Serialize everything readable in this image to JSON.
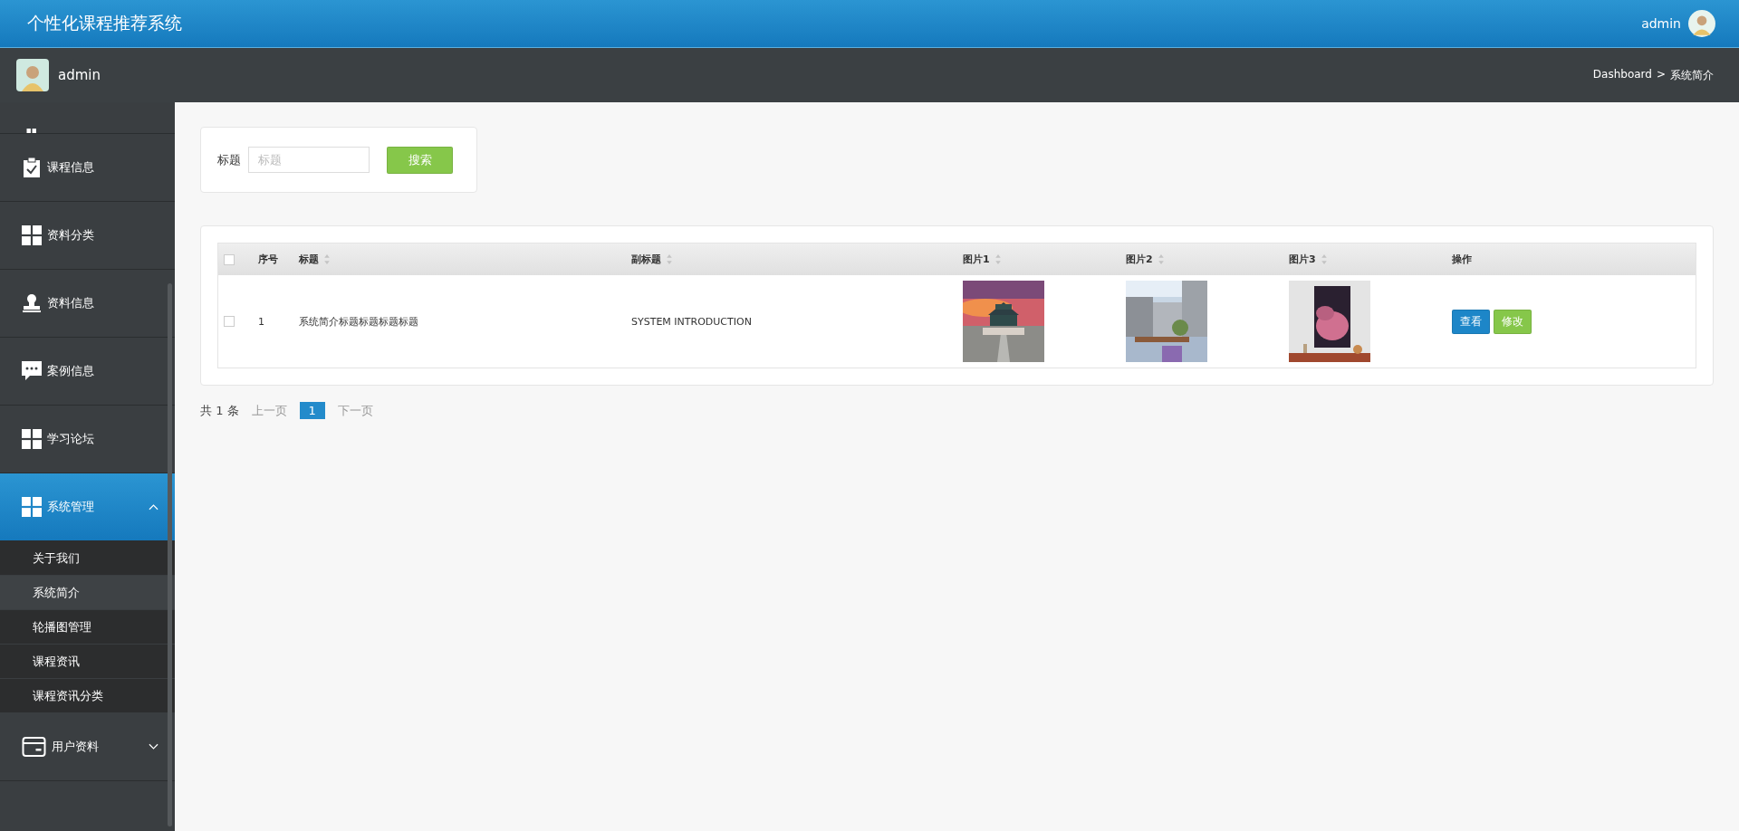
{
  "header": {
    "title": "个性化课程推荐系统",
    "user": "admin"
  },
  "subheader": {
    "user": "admin",
    "breadcrumb": [
      "Dashboard",
      ">",
      "系统简介"
    ]
  },
  "sidebar": {
    "items": [
      {
        "label": "课程信息",
        "kind": "clipboard",
        "selected": false
      },
      {
        "label": "资料分类",
        "kind": "grid",
        "selected": false
      },
      {
        "label": "资料信息",
        "kind": "stamp",
        "selected": false
      },
      {
        "label": "案例信息",
        "kind": "chat",
        "selected": false
      },
      {
        "label": "学习论坛",
        "kind": "grid",
        "selected": false
      },
      {
        "label": "系统管理",
        "kind": "grid",
        "expanded": true,
        "selected": true,
        "children": [
          {
            "label": "关于我们",
            "selected": false
          },
          {
            "label": "系统简介",
            "selected": true
          },
          {
            "label": "轮播图管理",
            "selected": false
          },
          {
            "label": "课程资讯",
            "selected": false
          },
          {
            "label": "课程资讯分类",
            "selected": false
          }
        ]
      },
      {
        "label": "用户资料",
        "kind": "card",
        "expanded": false,
        "selected": false
      }
    ]
  },
  "search": {
    "label": "标题",
    "placeholder": "标题",
    "button": "搜索"
  },
  "table": {
    "all_checked": false,
    "columns": [
      {
        "label": "序号",
        "sortable": false
      },
      {
        "label": "标题",
        "sortable": true
      },
      {
        "label": "副标题",
        "sortable": true
      },
      {
        "label": "图片1",
        "sortable": true
      },
      {
        "label": "图片2",
        "sortable": true
      },
      {
        "label": "图片3",
        "sortable": true
      },
      {
        "label": "操作",
        "sortable": false
      }
    ],
    "rows": [
      {
        "checked": false,
        "cells": [
          "1",
          "系统简介标题标题标题标题",
          "SYSTEM INTRODUCTION"
        ],
        "pictures": [
          {
            "kind": "picture"
          },
          {
            "kind": "picture"
          },
          {
            "kind": "picture"
          }
        ],
        "actions": [
          "查看",
          "修改"
        ]
      }
    ]
  },
  "pagination": {
    "total": "共 1 条",
    "prev": "上一页",
    "pages": [
      {
        "label": "1",
        "selected": true
      }
    ],
    "next": "下一页"
  }
}
